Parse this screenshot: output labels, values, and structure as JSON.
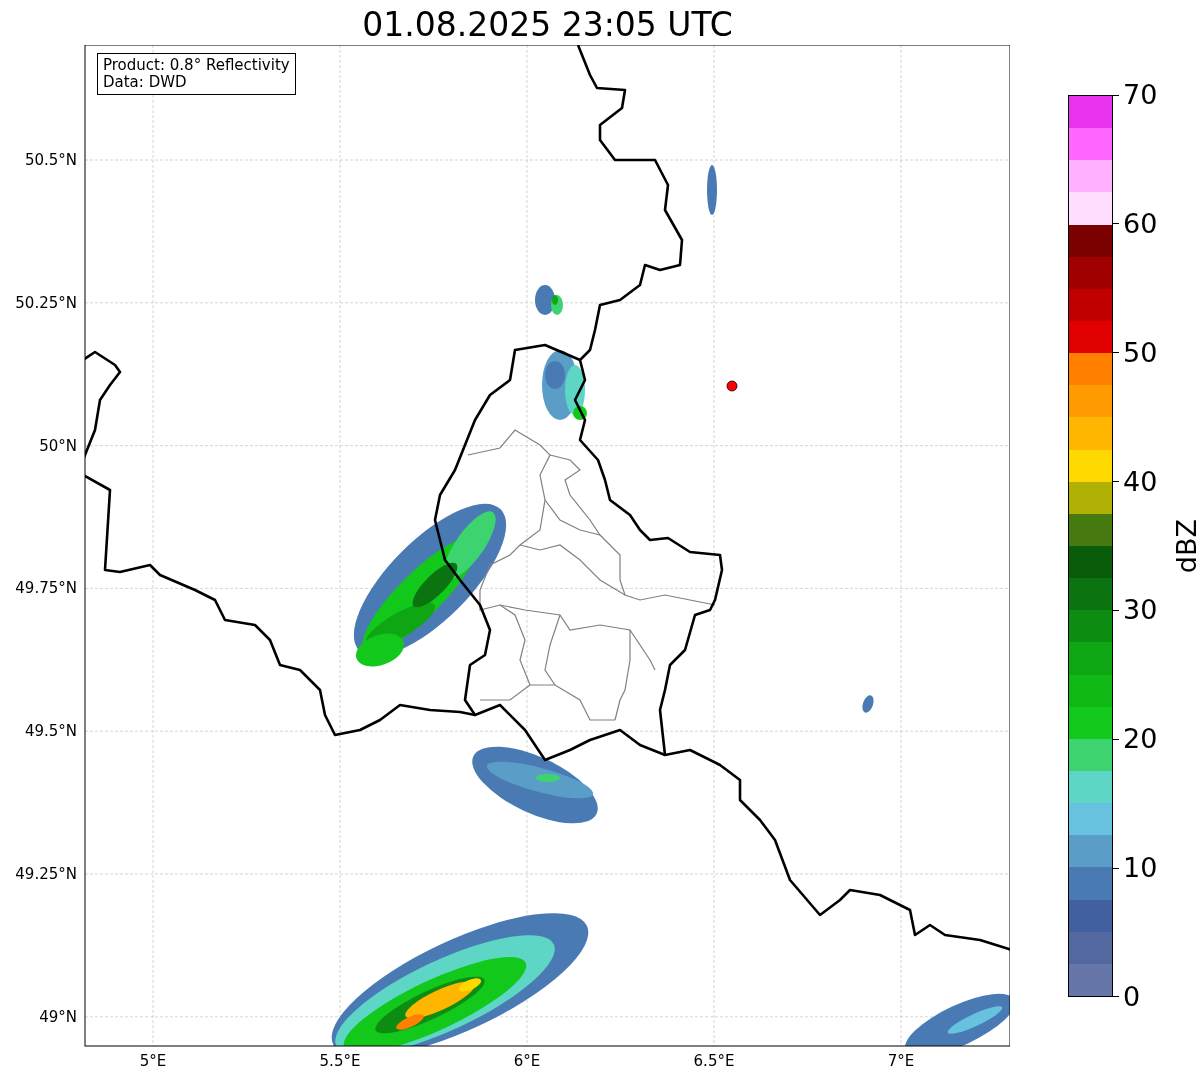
{
  "title": "01.08.2025 23:05 UTC",
  "annotation": [
    "Product: 0.8° Reflectivity",
    "Data: DWD"
  ],
  "map": {
    "xticks": [
      "5°E",
      "5.5°E",
      "6°E",
      "6.5°E",
      "7°E"
    ],
    "yticks": [
      "50.5°N",
      "50.25°N",
      "50°N",
      "49.75°N",
      "49.5°N",
      "49.25°N",
      "49°N"
    ]
  },
  "colorbar": {
    "label": "dBZ",
    "ticks": [
      "70",
      "60",
      "50",
      "40",
      "30",
      "20",
      "10",
      "0"
    ],
    "bands": [
      {
        "color": "#e833ee"
      },
      {
        "color": "#ff66ff"
      },
      {
        "color": "#ffb0ff"
      },
      {
        "color": "#ffdeff"
      },
      {
        "color": "#7b0000"
      },
      {
        "color": "#a00000"
      },
      {
        "color": "#c00000"
      },
      {
        "color": "#e00000"
      },
      {
        "color": "#ff8000"
      },
      {
        "color": "#ff9a00"
      },
      {
        "color": "#ffb600"
      },
      {
        "color": "#ffd800"
      },
      {
        "color": "#b0b005"
      },
      {
        "color": "#467a10"
      },
      {
        "color": "#095c0a"
      },
      {
        "color": "#0b7410"
      },
      {
        "color": "#0d8c12"
      },
      {
        "color": "#0fa614"
      },
      {
        "color": "#10b816"
      },
      {
        "color": "#12c81a"
      },
      {
        "color": "#3dd470"
      },
      {
        "color": "#5dd6c6"
      },
      {
        "color": "#66c2de"
      },
      {
        "color": "#5a9ec8"
      },
      {
        "color": "#4a7ab4"
      },
      {
        "color": "#4260a0"
      },
      {
        "color": "#5468a0"
      },
      {
        "color": "#6676a8"
      }
    ]
  }
}
